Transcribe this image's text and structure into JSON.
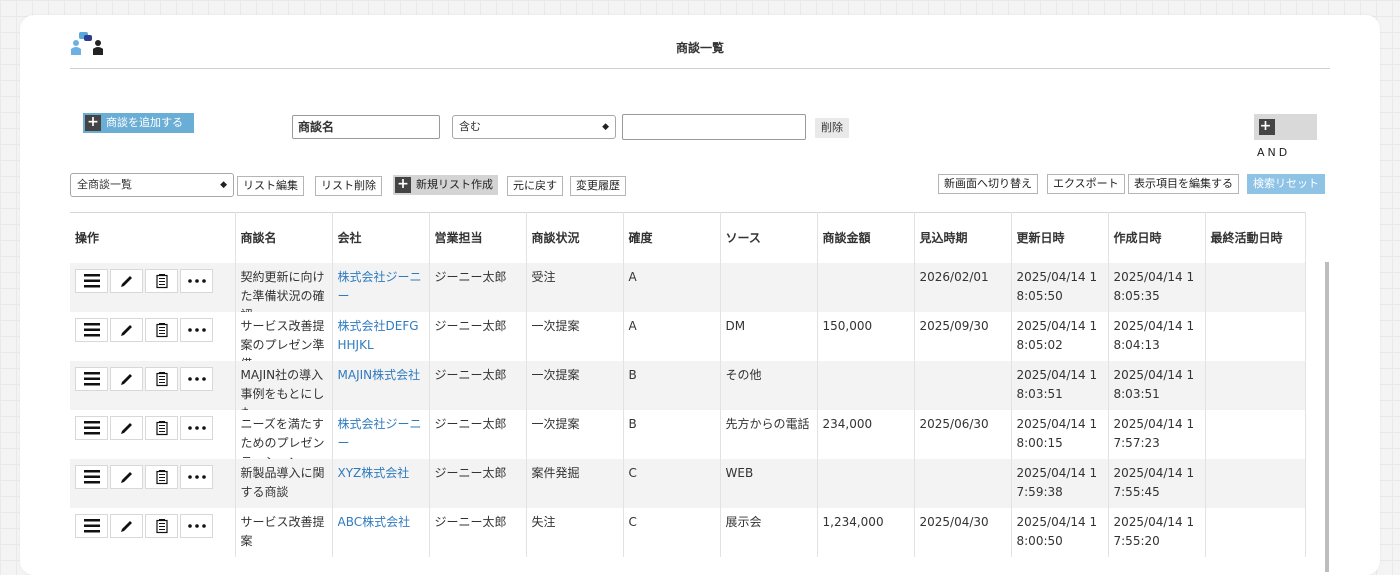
{
  "header": {
    "title": "商談一覧"
  },
  "toolbar": {
    "add_button": "商談を追加する",
    "filter_field": "商談名",
    "filter_operator": "含む",
    "filter_value": "",
    "delete_button": "削除",
    "and_button": "AND"
  },
  "listbar": {
    "list_select": "全商談一覧",
    "edit_list": "リスト編集",
    "delete_list": "リスト削除",
    "new_list": "新規リスト作成",
    "undo": "元に戻す",
    "history": "変更履歴",
    "switch_view": "新画面へ切り替え",
    "export": "エクスポート",
    "edit_columns": "表示項目を編集する",
    "reset_search": "検索リセット"
  },
  "table": {
    "columns": [
      "操作",
      "商談名",
      "会社",
      "営業担当",
      "商談状況",
      "確度",
      "ソース",
      "商談金額",
      "見込時期",
      "更新日時",
      "作成日時",
      "最終活動日時"
    ],
    "rows": [
      {
        "name": "契約更新に向けた準備状況の確認",
        "company": "株式会社ジーニー",
        "rep": "ジーニー太郎",
        "status": "受注",
        "prob": "A",
        "source": "",
        "amount": "",
        "expected": "2026/02/01",
        "updated": "2025/04/14 18:05:50",
        "created": "2025/04/14 18:05:35",
        "last": ""
      },
      {
        "name": "サービス改善提案のプレゼン準備",
        "company": "株式会社DEFGHHJKL",
        "rep": "ジーニー太郎",
        "status": "一次提案",
        "prob": "A",
        "source": "DM",
        "amount": "150,000",
        "expected": "2025/09/30",
        "updated": "2025/04/14 18:05:02",
        "created": "2025/04/14 18:04:13",
        "last": ""
      },
      {
        "name": "MAJIN社の導入事例をもとにした…",
        "company": "MAJIN株式会社",
        "rep": "ジーニー太郎",
        "status": "一次提案",
        "prob": "B",
        "source": "その他",
        "amount": "",
        "expected": "",
        "updated": "2025/04/14 18:03:51",
        "created": "2025/04/14 18:03:51",
        "last": ""
      },
      {
        "name": "ニーズを満たすためのプレゼンテーション",
        "company": "株式会社ジーニー",
        "rep": "ジーニー太郎",
        "status": "一次提案",
        "prob": "B",
        "source": "先方からの電話",
        "amount": "234,000",
        "expected": "2025/06/30",
        "updated": "2025/04/14 18:00:15",
        "created": "2025/04/14 17:57:23",
        "last": ""
      },
      {
        "name": "新製品導入に関する商談",
        "company": "XYZ株式会社",
        "rep": "ジーニー太郎",
        "status": "案件発掘",
        "prob": "C",
        "source": "WEB",
        "amount": "",
        "expected": "",
        "updated": "2025/04/14 17:59:38",
        "created": "2025/04/14 17:55:45",
        "last": ""
      },
      {
        "name": "サービス改善提案",
        "company": "ABC株式会社",
        "rep": "ジーニー太郎",
        "status": "失注",
        "prob": "C",
        "source": "展示会",
        "amount": "1,234,000",
        "expected": "2025/04/30",
        "updated": "2025/04/14 18:00:50",
        "created": "2025/04/14 17:55:20",
        "last": ""
      }
    ]
  },
  "icons": {
    "menu": "hamburger-menu-icon",
    "edit": "pencil-icon",
    "copy": "document-icon",
    "more": "more-horizontal-icon"
  },
  "colors": {
    "accent": "#6aaed6",
    "link": "#2f7bbf",
    "reset": "#8ec3e6"
  }
}
